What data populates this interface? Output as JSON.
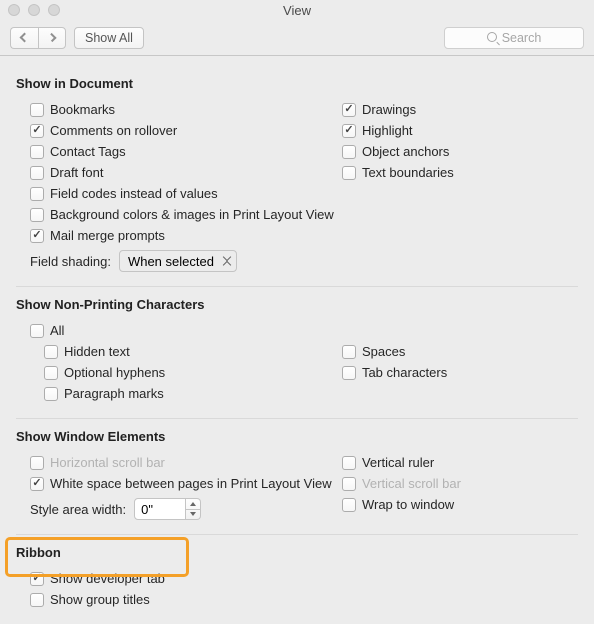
{
  "window": {
    "title": "View"
  },
  "toolbar": {
    "show_all": "Show All",
    "search_placeholder": "Search"
  },
  "sections": {
    "show_in_document": {
      "heading": "Show in Document",
      "left": [
        {
          "label": "Bookmarks",
          "checked": false
        },
        {
          "label": "Comments on rollover",
          "checked": true
        },
        {
          "label": "Contact Tags",
          "checked": false
        },
        {
          "label": "Draft font",
          "checked": false
        },
        {
          "label": "Field codes instead of values",
          "checked": false
        },
        {
          "label": "Background colors & images in Print Layout View",
          "checked": false
        },
        {
          "label": "Mail merge prompts",
          "checked": true
        }
      ],
      "right": [
        {
          "label": "Drawings",
          "checked": true
        },
        {
          "label": "Highlight",
          "checked": true
        },
        {
          "label": "Object anchors",
          "checked": false
        },
        {
          "label": "Text boundaries",
          "checked": false
        }
      ],
      "field_shading_label": "Field shading:",
      "field_shading_value": "When selected"
    },
    "nonprinting": {
      "heading": "Show Non-Printing Characters",
      "all": {
        "label": "All",
        "checked": false
      },
      "left": [
        {
          "label": "Hidden text",
          "checked": false
        },
        {
          "label": "Optional hyphens",
          "checked": false
        },
        {
          "label": "Paragraph marks",
          "checked": false
        }
      ],
      "right": [
        {
          "label": "Spaces",
          "checked": false
        },
        {
          "label": "Tab characters",
          "checked": false
        }
      ]
    },
    "window_elements": {
      "heading": "Show Window Elements",
      "left": [
        {
          "label": "Horizontal scroll bar",
          "checked": false,
          "disabled": true
        },
        {
          "label": "White space between pages in Print Layout View",
          "checked": true
        }
      ],
      "right": [
        {
          "label": "Vertical ruler",
          "checked": false
        },
        {
          "label": "Vertical scroll bar",
          "checked": false,
          "disabled": true
        },
        {
          "label": "Wrap to window",
          "checked": false
        }
      ],
      "style_width_label": "Style area width:",
      "style_width_value": "0\""
    },
    "ribbon": {
      "heading": "Ribbon",
      "items": [
        {
          "label": "Show developer tab",
          "checked": true
        },
        {
          "label": "Show group titles",
          "checked": false
        }
      ]
    }
  }
}
